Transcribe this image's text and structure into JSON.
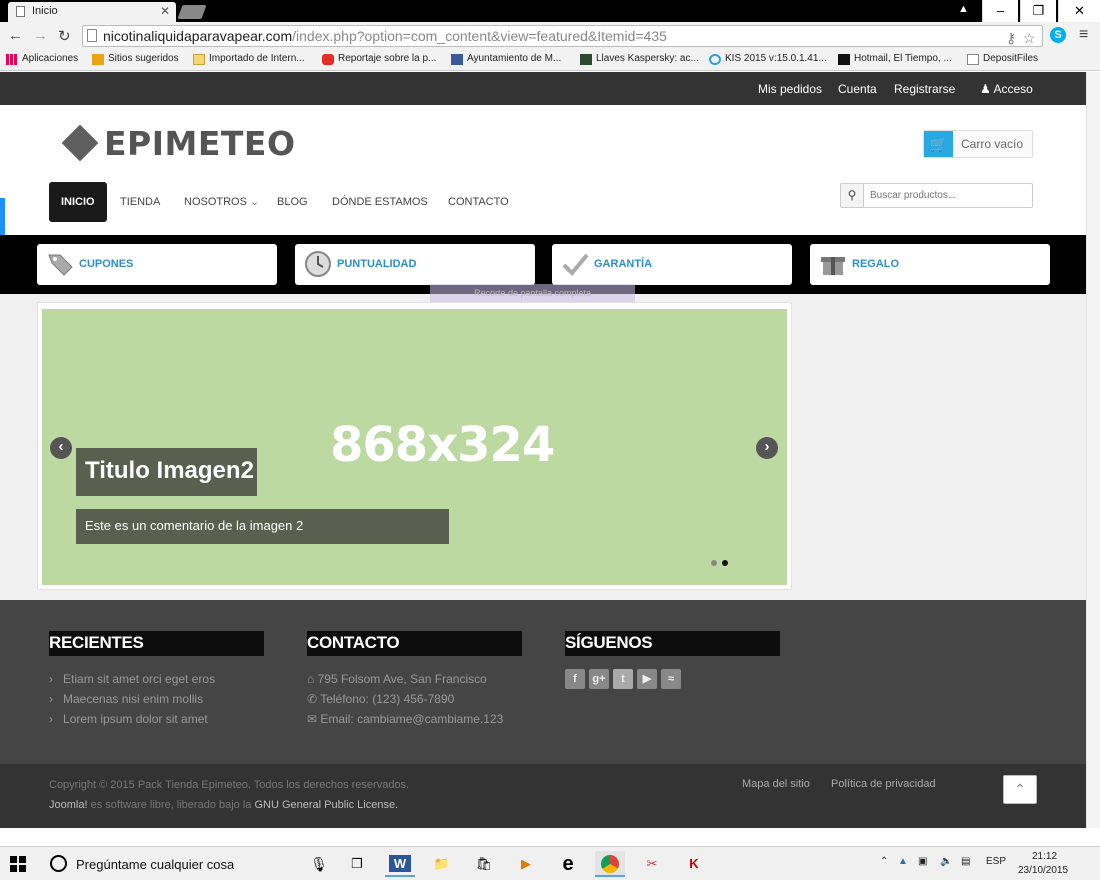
{
  "browser": {
    "tab_title": "Inicio",
    "url_host": "nicotinaliquidaparavapear.com",
    "url_path": "/index.php?option=com_content&view=featured&Itemid=435",
    "bookmarks": [
      "Aplicaciones",
      "Sitios sugeridos",
      "Importado de Intern...",
      "Reportaje sobre la p...",
      "Ayuntamiento de M...",
      "Llaves Kaspersky: ac...",
      "KIS 2015 v:15.0.1.41...",
      "Hotmail, El Tiempo, ...",
      "DepositFiles"
    ]
  },
  "site": {
    "top_links": [
      "Mis pedidos",
      "Cuenta",
      "Registrarse",
      "Acceso"
    ],
    "logo": "EPIMETEO",
    "cart_label": "Carro vacío",
    "menu": [
      "INICIO",
      "TIENDA",
      "NOSOTROS",
      "BLOG",
      "DÓNDE ESTAMOS",
      "CONTACTO"
    ],
    "search_placeholder": "Buscar productos...",
    "features": [
      "CUPONES",
      "PUNTUALIDAD",
      "GARANTÍA",
      "REGALO"
    ],
    "tooltip": "Recorte de pantalla completa",
    "slide": {
      "size_text": "868x324",
      "title": "Titulo Imagen2",
      "caption": "Este es un comentario de la imagen 2",
      "active_index": 2,
      "count": 2
    },
    "footer": {
      "recientes_title": "RECIENTES",
      "recientes": [
        "Etiam sit amet orci eget eros",
        "Maecenas nisi enim mollis",
        "Lorem ipsum dolor sit amet"
      ],
      "contacto_title": "CONTACTO",
      "address": "795 Folsom Ave, San Francisco",
      "phone": "Teléfono: (123) 456-7890",
      "email": "Email: cambiame@cambiame.123",
      "siguenos_title": "SÍGUENOS",
      "social_icons": [
        "facebook-icon",
        "google-plus-icon",
        "twitter-icon",
        "youtube-icon",
        "rss-icon"
      ]
    },
    "bottom": {
      "copyright": "Copyright © 2015 Pack Tienda Epimeteo. Todos los derechos reservados.",
      "joomla_brand": "Joomla!",
      "joomla_mid": "es software libre, liberado bajo la",
      "license": "GNU General Public License.",
      "sitemap": "Mapa del sitio",
      "privacy": "Política de privacidad"
    }
  },
  "taskbar": {
    "search_text": "Pregúntame cualquier cosa",
    "lang": "ESP",
    "time": "21:12",
    "date": "23/10/2015"
  },
  "colors": {
    "accent_blue": "#2a8fd0",
    "cart_blue": "#27a9e3",
    "slide_green": "#bcd9a1",
    "topbar": "#333333",
    "footer": "#454545"
  }
}
